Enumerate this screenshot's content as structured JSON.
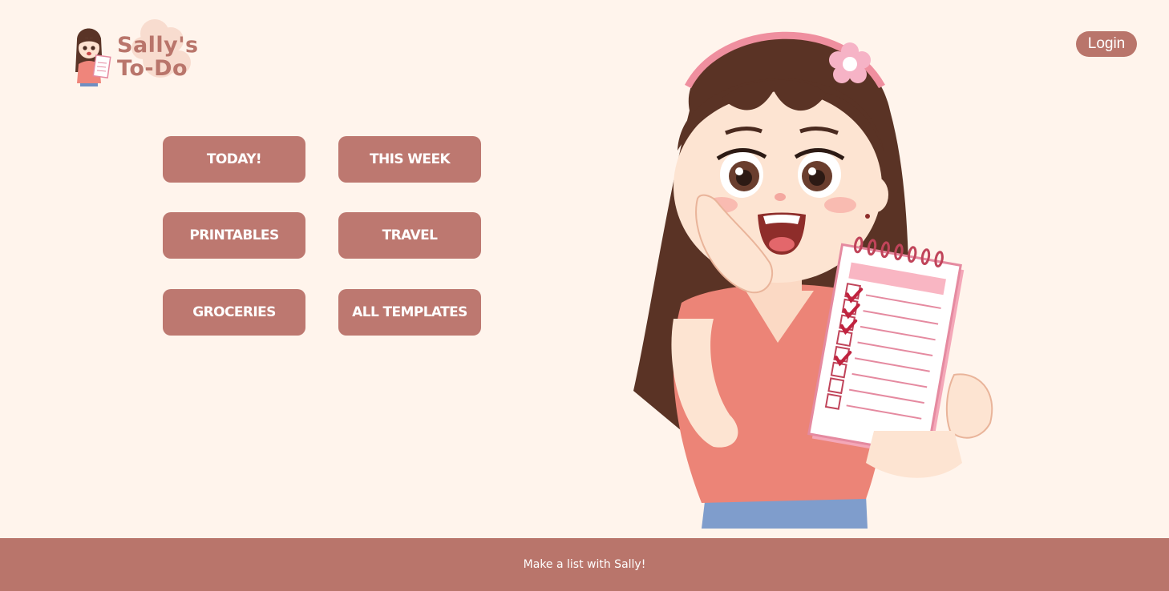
{
  "brand": {
    "line1": "Sally's",
    "line2": "To-Do"
  },
  "header": {
    "login_label": "Login"
  },
  "nav": {
    "today": "TODAY!",
    "this_week": "THIS WEEK",
    "printables": "PRINTABLES",
    "travel": "TRAVEL",
    "groceries": "GROCERIES",
    "all_templates": "ALL TEMPLATES"
  },
  "footer": {
    "tagline": "Make a list with Sally!"
  },
  "colors": {
    "background": "#fff4ec",
    "accent": "#b9756b",
    "button": "#bd7870",
    "text_on_accent": "#ffffff"
  },
  "icons": {
    "logo": "sally-mascot-icon",
    "hero": "sally-with-checklist-illustration"
  }
}
